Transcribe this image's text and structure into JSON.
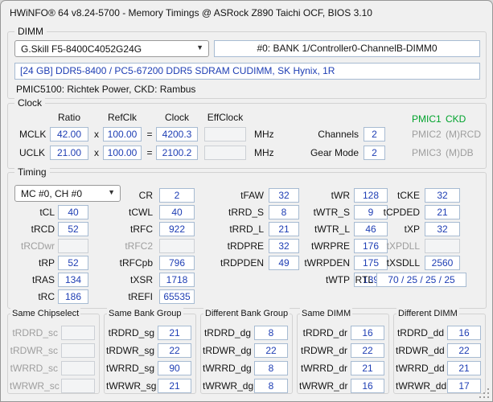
{
  "window": {
    "title": "HWiNFO® 64 v8.24-5700 - Memory Timings @ ASRock Z890 Taichi OCF, BIOS 3.10"
  },
  "colors": {
    "value_text": "#1e3eb4",
    "pmic_active": "#00a32c",
    "disabled_text": "#9e9e9e"
  },
  "dimm": {
    "group_label": "DIMM",
    "module_select": "G.Skill F5-8400C4052G24G",
    "slot": "#0: BANK 1/Controller0-ChannelB-DIMM0",
    "description": "[24 GB] DDR5-8400 / PC5-67200 DDR5 SDRAM CUDIMM, SK Hynix, 1R",
    "pmic_line": "PMIC5100: Richtek Power, CKD: Rambus"
  },
  "clock": {
    "group_label": "Clock",
    "headers": {
      "ratio": "Ratio",
      "refclk": "RefClk",
      "clock": "Clock",
      "effclock": "EffClock"
    },
    "mul_sign": "x",
    "eq_sign": "=",
    "mclk": {
      "label": "MCLK",
      "ratio": "42.00",
      "refclk": "100.00",
      "clock": "4200.3",
      "effclock": "",
      "unit": "MHz"
    },
    "uclk": {
      "label": "UCLK",
      "ratio": "21.00",
      "refclk": "100.00",
      "clock": "2100.2",
      "effclock": "",
      "unit": "MHz"
    },
    "channels": {
      "label": "Channels",
      "value": "2"
    },
    "gear_mode": {
      "label": "Gear Mode",
      "value": "2"
    },
    "pmic1": {
      "label": "PMIC1",
      "value": "CKD"
    },
    "pmic2": {
      "label": "PMIC2",
      "value": "(M)RCD"
    },
    "pmic3": {
      "label": "PMIC3",
      "value": "(M)DB"
    }
  },
  "timing": {
    "group_label": "Timing",
    "channel_select": "MC #0, CH #0",
    "cells": {
      "CR": {
        "label": "CR",
        "value": "2"
      },
      "tCL": {
        "label": "tCL",
        "value": "40"
      },
      "tRCD": {
        "label": "tRCD",
        "value": "52"
      },
      "tRCDwr": {
        "label": "tRCDwr",
        "value": ""
      },
      "tRP": {
        "label": "tRP",
        "value": "52"
      },
      "tRAS": {
        "label": "tRAS",
        "value": "134"
      },
      "tRC": {
        "label": "tRC",
        "value": "186"
      },
      "tCWL": {
        "label": "tCWL",
        "value": "40"
      },
      "tRFC": {
        "label": "tRFC",
        "value": "922"
      },
      "tRFC2": {
        "label": "tRFC2",
        "value": ""
      },
      "tRFCpb": {
        "label": "tRFCpb",
        "value": "796"
      },
      "tXSR": {
        "label": "tXSR",
        "value": "1718"
      },
      "tREFI": {
        "label": "tREFI",
        "value": "65535"
      },
      "tFAW": {
        "label": "tFAW",
        "value": "32"
      },
      "tRRD_S": {
        "label": "tRRD_S",
        "value": "8"
      },
      "tRRD_L": {
        "label": "tRRD_L",
        "value": "21"
      },
      "tRDPRE": {
        "label": "tRDPRE",
        "value": "32"
      },
      "tRDPDEN": {
        "label": "tRDPDEN",
        "value": "49"
      },
      "tWR": {
        "label": "tWR",
        "value": "128"
      },
      "tWTR_S": {
        "label": "tWTR_S",
        "value": "9"
      },
      "tWTR_L": {
        "label": "tWTR_L",
        "value": "46"
      },
      "tWRPRE": {
        "label": "tWRPRE",
        "value": "176"
      },
      "tWRPDEN": {
        "label": "tWRPDEN",
        "value": "175"
      },
      "tWTP": {
        "label": "tWTP",
        "value": "139"
      },
      "tCKE": {
        "label": "tCKE",
        "value": "32"
      },
      "tCPDED": {
        "label": "tCPDED",
        "value": "21"
      },
      "tXP": {
        "label": "tXP",
        "value": "32"
      },
      "tXPDLL": {
        "label": "tXPDLL",
        "value": ""
      },
      "tXSDLL": {
        "label": "tXSDLL",
        "value": "2560"
      },
      "RTL": {
        "label": "RTL",
        "value": "70 / 25 / 25 / 25"
      }
    }
  },
  "bottom_groups": [
    {
      "title": "Same Chipselect",
      "rows": [
        {
          "label": "tRDRD_sc",
          "value": ""
        },
        {
          "label": "tRDWR_sc",
          "value": ""
        },
        {
          "label": "tWRRD_sc",
          "value": ""
        },
        {
          "label": "tWRWR_sc",
          "value": ""
        }
      ]
    },
    {
      "title": "Same Bank Group",
      "rows": [
        {
          "label": "tRDRD_sg",
          "value": "21"
        },
        {
          "label": "tRDWR_sg",
          "value": "22"
        },
        {
          "label": "tWRRD_sg",
          "value": "90"
        },
        {
          "label": "tWRWR_sg",
          "value": "21"
        }
      ]
    },
    {
      "title": "Different Bank Group",
      "rows": [
        {
          "label": "tRDRD_dg",
          "value": "8"
        },
        {
          "label": "tRDWR_dg",
          "value": "22"
        },
        {
          "label": "tWRRD_dg",
          "value": "8"
        },
        {
          "label": "tWRWR_dg",
          "value": "8"
        }
      ]
    },
    {
      "title": "Same DIMM",
      "rows": [
        {
          "label": "tRDRD_dr",
          "value": "16"
        },
        {
          "label": "tRDWR_dr",
          "value": "22"
        },
        {
          "label": "tWRRD_dr",
          "value": "21"
        },
        {
          "label": "tWRWR_dr",
          "value": "16"
        }
      ]
    },
    {
      "title": "Different DIMM",
      "rows": [
        {
          "label": "tRDRD_dd",
          "value": "16"
        },
        {
          "label": "tRDWR_dd",
          "value": "22"
        },
        {
          "label": "tWRRD_dd",
          "value": "21"
        },
        {
          "label": "tWRWR_dd",
          "value": "17"
        }
      ]
    }
  ]
}
